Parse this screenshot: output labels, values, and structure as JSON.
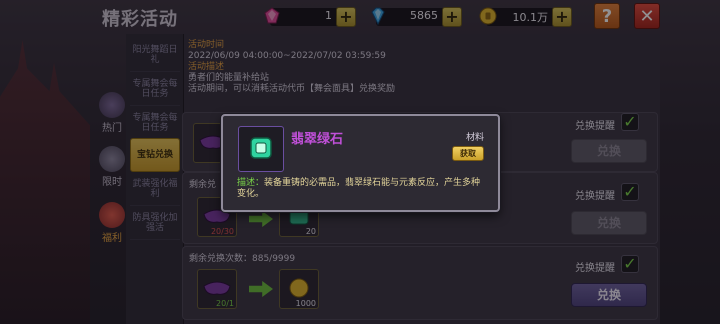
{
  "header": {
    "title": "精彩活动",
    "help_label": "?",
    "close_label": "✕"
  },
  "currencies": [
    {
      "icon": "pink-gem-icon",
      "value": "1",
      "color": "#e04a9a"
    },
    {
      "icon": "blue-diamond-icon",
      "value": "5865",
      "color": "#3aa6e6"
    },
    {
      "icon": "gold-coin-icon",
      "value": "10.1万",
      "color": "#e0b42a"
    }
  ],
  "plus_label": "+",
  "nav": [
    {
      "label": "热门",
      "icon": "hot-icon",
      "active": false
    },
    {
      "label": "限时",
      "icon": "clock-icon",
      "active": false
    },
    {
      "label": "福利",
      "icon": "gift-icon",
      "active": true
    }
  ],
  "submenu": [
    {
      "label": "阳光舞蹈日礼",
      "active": false
    },
    {
      "label": "专属舞会每日任务",
      "active": false
    },
    {
      "label": "专属舞会每日任务",
      "active": false
    },
    {
      "label": "宝钻兑换",
      "active": true
    },
    {
      "label": "武装强化福利",
      "active": false
    },
    {
      "label": "防具强化加强活",
      "active": false
    }
  ],
  "info": {
    "time_label": "活动时间",
    "time_value": "2022/06/09 04:00:00~2022/07/02 03:59:59",
    "desc_label": "活动描述",
    "desc_line1": "勇者们的能量补给站",
    "desc_line2": "活动期间，可以消耗活动代币【舞会面具】兑换奖励"
  },
  "rows": [
    {
      "remain": "",
      "from_count": "",
      "to_count": "",
      "remind": "兑换提醒",
      "btn": "兑换",
      "enabled": false
    },
    {
      "remain": "剩余兑",
      "from_count": "20/30",
      "to_count": "20",
      "remind": "兑换提醒",
      "btn": "兑换",
      "enabled": false
    },
    {
      "remain": "剩余兑换次数：885/9999",
      "from_count": "20/1",
      "to_count": "1000",
      "remind": "兑换提醒",
      "btn": "兑换",
      "enabled": true
    }
  ],
  "tooltip": {
    "name": "翡翠绿石",
    "type": "材料",
    "get_label": "获取",
    "desc_label": "描述：",
    "desc_text": "装备重铸的必需品，翡翠绿石能与元素反应，产生多种变化。"
  }
}
